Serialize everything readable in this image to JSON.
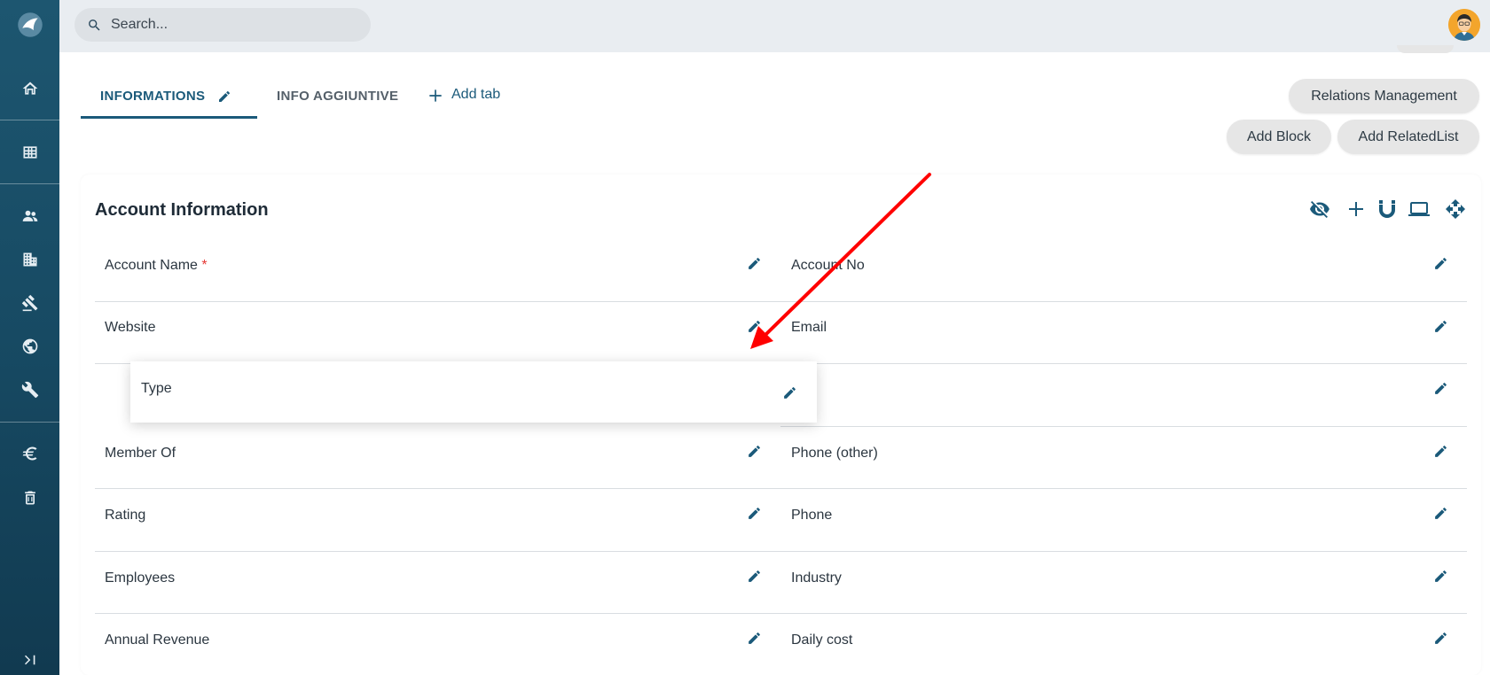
{
  "search": {
    "placeholder": "Search..."
  },
  "tabs": [
    {
      "label": "INFORMATIONS",
      "active": true
    },
    {
      "label": "INFO AGGIUNTIVE",
      "active": false
    }
  ],
  "add_tab_label": "Add tab",
  "buttons": {
    "relations_management": "Relations Management",
    "add_block": "Add Block",
    "add_related_list": "Add RelatedList"
  },
  "block": {
    "title": "Account Information",
    "tools": [
      "eye-off-icon",
      "plus-icon",
      "magnet-icon",
      "laptop-icon",
      "move-icon"
    ]
  },
  "fields_left": [
    {
      "label": "Account Name",
      "required": true
    },
    {
      "label": "Website"
    },
    {
      "label": ""
    },
    {
      "label": "Member Of"
    },
    {
      "label": "Rating"
    },
    {
      "label": "Employees"
    },
    {
      "label": "Annual Revenue"
    }
  ],
  "fields_right": [
    {
      "label": "Account No"
    },
    {
      "label": "Email"
    },
    {
      "label": ""
    },
    {
      "label": "Phone (other)"
    },
    {
      "label": "Phone"
    },
    {
      "label": "Industry"
    },
    {
      "label": "Daily cost"
    }
  ],
  "dragging_field": {
    "label": "Type"
  },
  "required_marker": "*",
  "colors": {
    "primary": "#1b5a7a",
    "sidebar": "#174a63",
    "arrow": "#ff0000",
    "required": "#e53935"
  },
  "sidebar_icons": [
    "home-icon",
    "grid-icon",
    "contacts-icon",
    "building-icon",
    "gavel-icon",
    "globe-icon",
    "wrench-icon",
    "euro-icon",
    "trash-icon",
    "expand-icon"
  ]
}
